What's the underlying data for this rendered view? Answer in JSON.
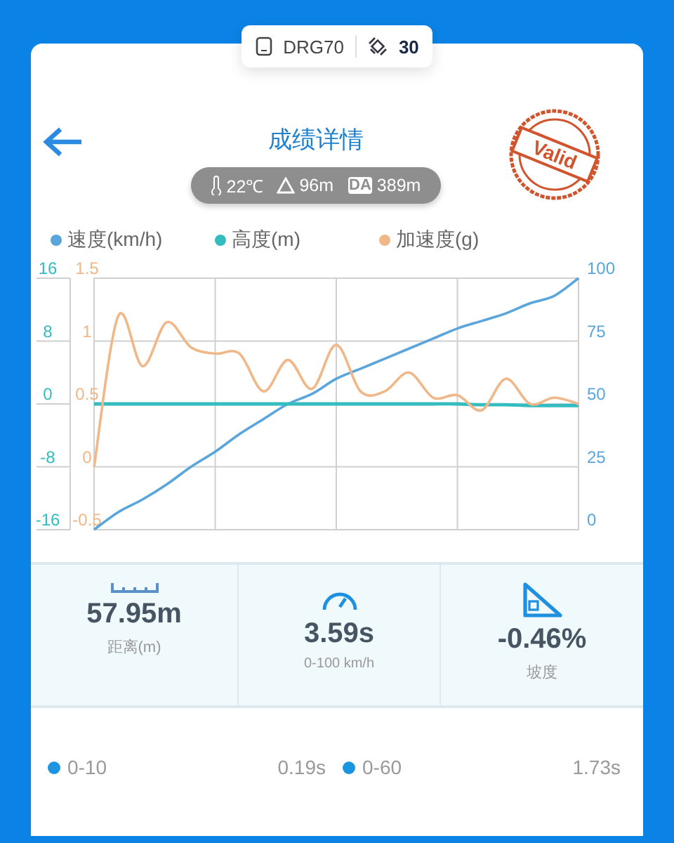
{
  "device_pill": {
    "device": "DRG70",
    "satellites": "30"
  },
  "header": {
    "title": "成绩详情",
    "stamp": "Valid"
  },
  "conditions": {
    "temperature": "22℃",
    "altitude": "96m",
    "da_badge": "DA",
    "density_altitude": "389m"
  },
  "chart": {
    "chart_data": {
      "type": "line",
      "grid": true,
      "ylim": [
        0,
        100
      ],
      "yticks": [
        100,
        75,
        50,
        25,
        0
      ],
      "y2lim": [
        -16,
        16
      ],
      "y2ticks": [
        16,
        8,
        0,
        -8,
        -16
      ],
      "y3lim": [
        -0.5,
        1.5
      ],
      "y3ticks": [
        1.5,
        1,
        0.5,
        0,
        -0.5
      ],
      "series": [
        {
          "name": "速度(km/h)",
          "color": "#5aa6dc",
          "values": [
            0,
            7,
            12,
            18,
            25,
            31,
            38,
            44,
            50,
            54,
            60,
            64,
            68,
            72,
            76,
            80,
            83,
            86,
            90,
            93,
            100
          ]
        },
        {
          "name": "高度(m)",
          "color": "#35bcc0",
          "axis": "y2",
          "values": [
            0,
            0,
            0,
            0,
            0,
            0,
            0,
            0,
            0,
            0,
            0,
            0,
            0,
            0,
            0,
            0,
            -0.1,
            -0.1,
            -0.2,
            -0.2,
            -0.2
          ]
        },
        {
          "name": "加速度(g)",
          "color": "#f0b888",
          "axis": "y3",
          "values": [
            0,
            1.2,
            0.8,
            1.15,
            0.95,
            0.9,
            0.9,
            0.6,
            0.85,
            0.62,
            0.97,
            0.6,
            0.6,
            0.75,
            0.55,
            0.57,
            0.45,
            0.7,
            0.5,
            0.55,
            0.5
          ]
        }
      ]
    }
  },
  "stats": [
    {
      "kind": "distance",
      "value": "57.95m",
      "label": "距离(m)"
    },
    {
      "kind": "time",
      "value": "3.59s",
      "label": "0-100 km/h"
    },
    {
      "kind": "slope",
      "value": "-0.46%",
      "label": "坡度"
    }
  ],
  "splits": [
    {
      "label": "0-10",
      "time": "0.19s",
      "color": "#1b95e0"
    },
    {
      "label": "0-60",
      "time": "1.73s",
      "color": "#1b95e0"
    }
  ]
}
